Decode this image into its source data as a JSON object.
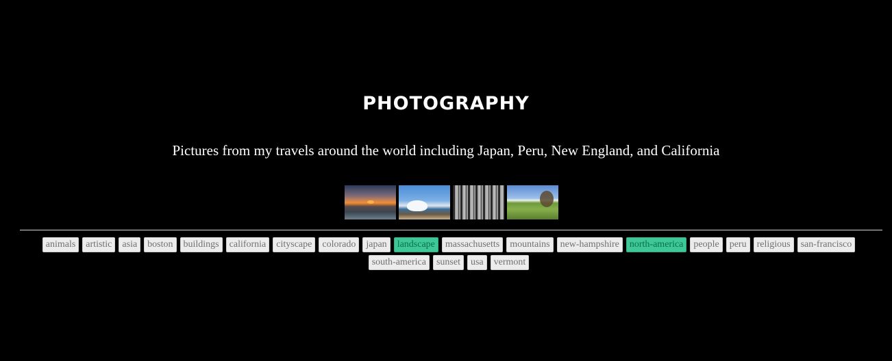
{
  "header": {
    "title": "PHOTOGRAPHY",
    "subtitle": "Pictures from my travels around the world including Japan, Peru, New England, and California"
  },
  "gallery": {
    "thumbnails": [
      {
        "name": "sunset-thumbnail"
      },
      {
        "name": "waves-thumbnail"
      },
      {
        "name": "forest-thumbnail"
      },
      {
        "name": "field-thumbnail"
      }
    ]
  },
  "tags": [
    {
      "label": "animals",
      "active": false
    },
    {
      "label": "artistic",
      "active": false
    },
    {
      "label": "asia",
      "active": false
    },
    {
      "label": "boston",
      "active": false
    },
    {
      "label": "buildings",
      "active": false
    },
    {
      "label": "california",
      "active": false
    },
    {
      "label": "cityscape",
      "active": false
    },
    {
      "label": "colorado",
      "active": false
    },
    {
      "label": "japan",
      "active": false
    },
    {
      "label": "landscape",
      "active": true
    },
    {
      "label": "massachusetts",
      "active": false
    },
    {
      "label": "mountains",
      "active": false
    },
    {
      "label": "new-hampshire",
      "active": false
    },
    {
      "label": "north-america",
      "active": true
    },
    {
      "label": "people",
      "active": false
    },
    {
      "label": "peru",
      "active": false
    },
    {
      "label": "religious",
      "active": false
    },
    {
      "label": "san-francisco",
      "active": false
    },
    {
      "label": "south-america",
      "active": false
    },
    {
      "label": "sunset",
      "active": false
    },
    {
      "label": "usa",
      "active": false
    },
    {
      "label": "vermont",
      "active": false
    }
  ],
  "colors": {
    "background": "#000000",
    "tag_active": "#3ec898",
    "tag_inactive": "#ececec"
  }
}
